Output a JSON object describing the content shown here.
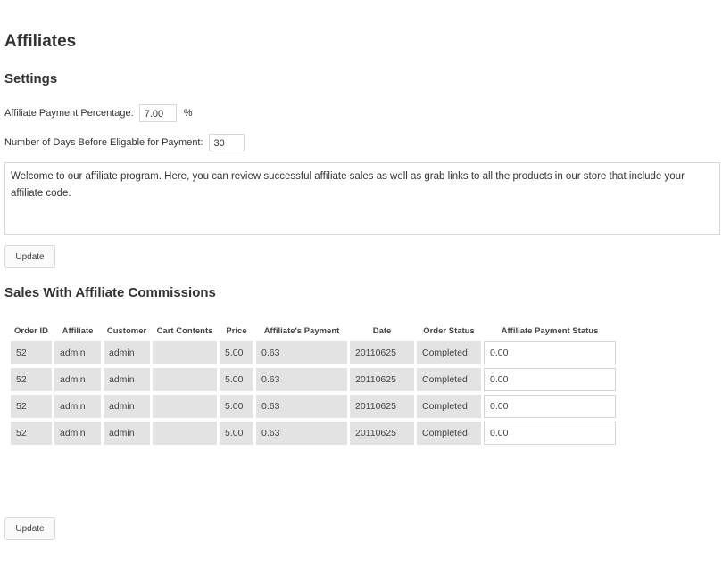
{
  "page": {
    "title": "Affiliates"
  },
  "settings": {
    "heading": "Settings",
    "percentage_label": "Affiliate Payment Percentage:",
    "percentage_value": "7.00",
    "percentage_unit": "%",
    "days_label": "Number of Days Before Eligable for Payment:",
    "days_value": "30",
    "welcome_text": "Welcome to our affiliate program.  Here, you can review successful affiliate sales as well as grab links to all the products in our store that include your affiliate code.",
    "update_label": "Update"
  },
  "sales": {
    "heading": "Sales With Affiliate Commissions",
    "columns": [
      "Order ID",
      "Affiliate",
      "Customer",
      "Cart Contents",
      "Price",
      "Affiliate's Payment",
      "Date",
      "Order Status",
      "Affiliate Payment Status"
    ],
    "rows": [
      {
        "order_id": "52",
        "affiliate": "admin",
        "customer": "admin",
        "cart": "",
        "price": "5.00",
        "payment": "0.63",
        "date": "20110625",
        "order_status": "Completed",
        "payment_status": "0.00"
      },
      {
        "order_id": "52",
        "affiliate": "admin",
        "customer": "admin",
        "cart": "",
        "price": "5.00",
        "payment": "0.63",
        "date": "20110625",
        "order_status": "Completed",
        "payment_status": "0.00"
      },
      {
        "order_id": "52",
        "affiliate": "admin",
        "customer": "admin",
        "cart": "",
        "price": "5.00",
        "payment": "0.63",
        "date": "20110625",
        "order_status": "Completed",
        "payment_status": "0.00"
      },
      {
        "order_id": "52",
        "affiliate": "admin",
        "customer": "admin",
        "cart": "",
        "price": "5.00",
        "payment": "0.63",
        "date": "20110625",
        "order_status": "Completed",
        "payment_status": "0.00"
      }
    ],
    "update_label": "Update"
  }
}
